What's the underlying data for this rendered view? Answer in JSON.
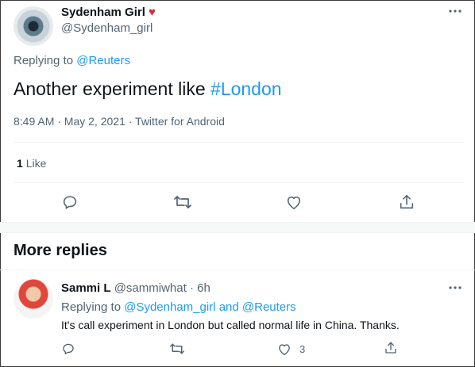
{
  "tweet": {
    "author": {
      "name": "Sydenham Girl",
      "handle": "@Sydenham_girl"
    },
    "more_icon": "more-horizontal-icon",
    "replying_prefix": "Replying to",
    "replying_to": "@Reuters",
    "text_prefix": "Another experiment like",
    "hashtag": "#London",
    "meta": "8:49 AM · May 2, 2021 · Twitter for Android",
    "likes_count": "1",
    "likes_label": "Like",
    "actions": [
      "reply-icon",
      "retweet-icon",
      "like-icon",
      "share-icon"
    ]
  },
  "more_replies": {
    "title": "More replies",
    "reply": {
      "name": "Sammi L",
      "handle": "@sammiwhat",
      "time": "· 6h",
      "replying_prefix": "Replying to",
      "mention_1": "@Sydenham_girl",
      "and_word": "and",
      "mention_2": "@Reuters",
      "text": "It's call experiment in London but called normal life in China. Thanks.",
      "like_count": "3"
    }
  },
  "colors": {
    "accent": "#1d9bf0",
    "heart": "#d92b3a",
    "muted": "#536471"
  }
}
